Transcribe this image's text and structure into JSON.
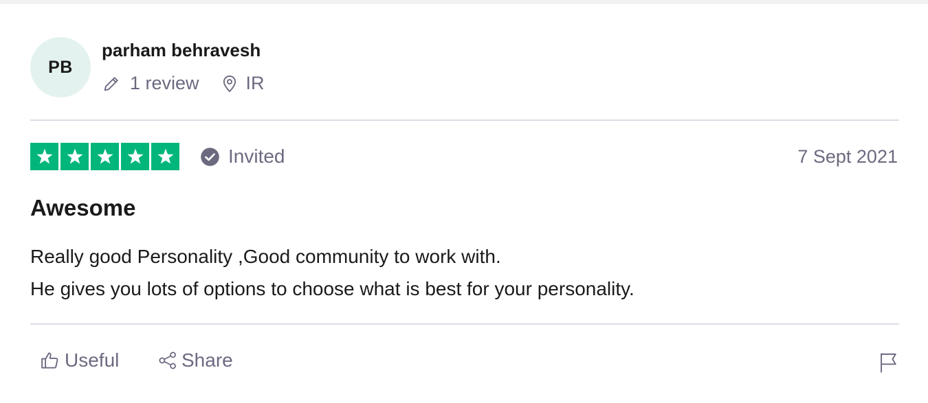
{
  "reviewer": {
    "initials": "PB",
    "name": "parham behravesh",
    "review_count": "1 review",
    "country": "IR",
    "avatar_color": "#e3f2ee"
  },
  "rating": {
    "stars": 5,
    "max_stars": 5,
    "star_color": "#00b67a",
    "status_label": "Invited",
    "date": "7 Sept 2021"
  },
  "review": {
    "title": "Awesome",
    "body_lines": [
      "Really good Personality ,Good community to work with.",
      "He gives you lots of options to choose what is best for your personality."
    ]
  },
  "actions": {
    "useful_label": "Useful",
    "share_label": "Share",
    "icons": [
      "thumbs-up-icon",
      "share-icon",
      "flag-icon"
    ]
  },
  "colors": {
    "muted_text": "#6b6a80",
    "divider": "#dcdce6"
  }
}
